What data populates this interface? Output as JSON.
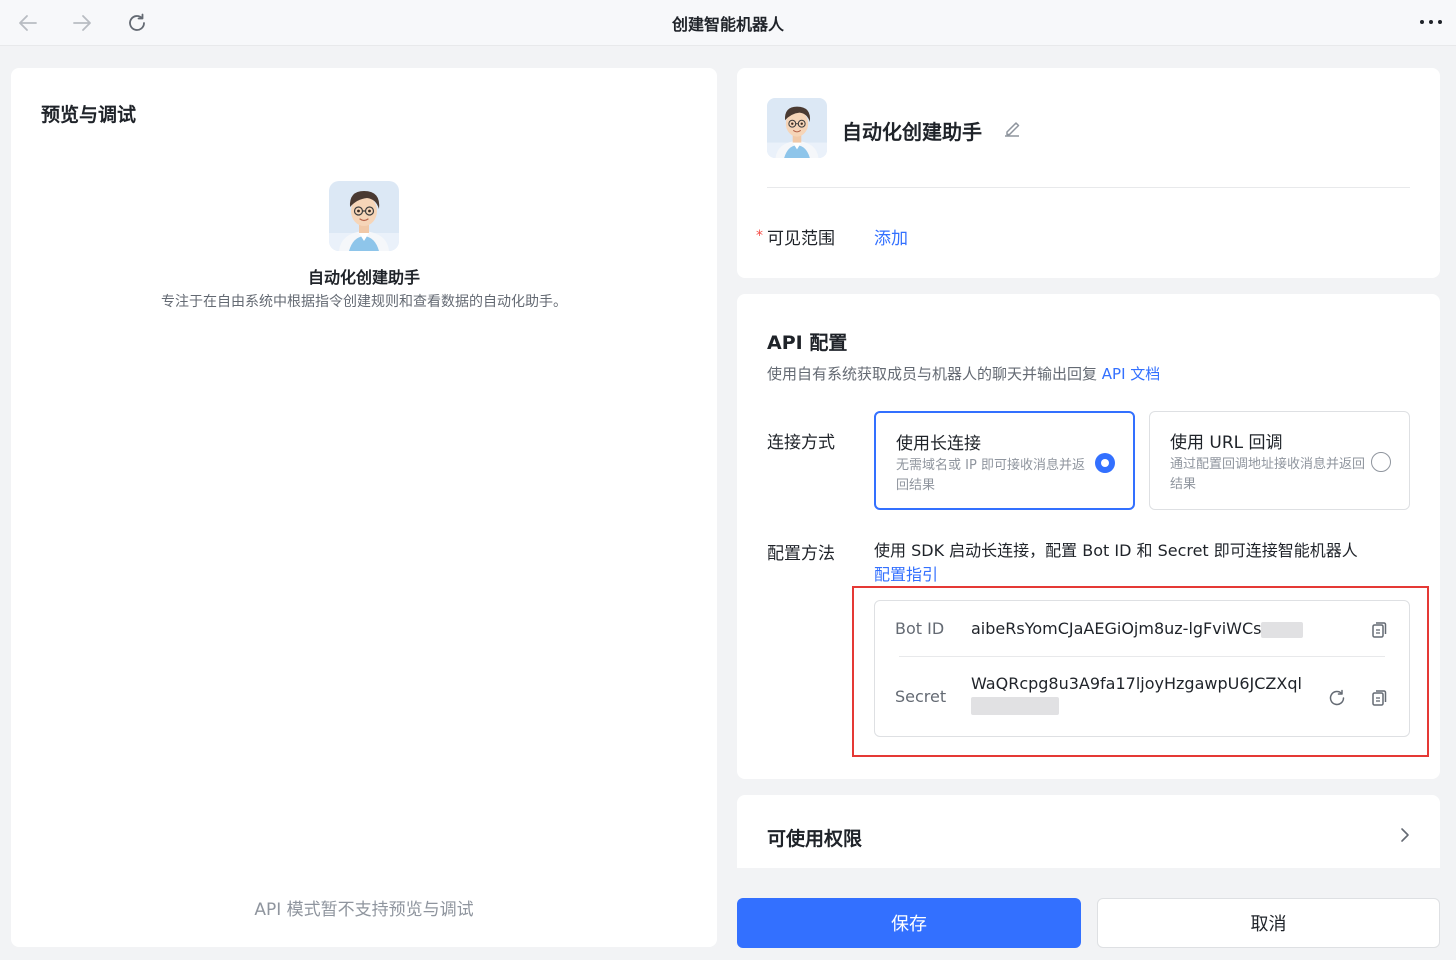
{
  "window": {
    "title": "创建智能机器人"
  },
  "icons": {
    "back": "arrow-left-icon",
    "forward": "arrow-right-icon",
    "refresh": "refresh-icon",
    "more": "more-icon",
    "edit": "pencil-icon",
    "copy": "copy-icon",
    "regenerate": "refresh-icon",
    "chevron": "chevron-right-icon"
  },
  "preview": {
    "title": "预览与调试",
    "bot_name": "自动化创建助手",
    "bot_desc": "专注于在自由系统中根据指令创建规则和查看数据的自动化助手。",
    "notice": "API 模式暂不支持预览与调试"
  },
  "profile": {
    "name": "自动化创建助手",
    "required_mark": "*",
    "visible_label": "可见范围",
    "visible_action": "添加"
  },
  "api": {
    "title": "API 配置",
    "desc": "使用自有系统获取成员与机器人的聊天并输出回复",
    "doc_link": "API 文档",
    "connection_label": "连接方式",
    "options": [
      {
        "title": "使用长连接",
        "desc": "无需域名或 IP 即可接收消息并返回结果",
        "selected": true
      },
      {
        "title": "使用 URL 回调",
        "desc": "通过配置回调地址接收消息并返回结果",
        "selected": false
      }
    ],
    "method_label": "配置方法",
    "method_text": "使用 SDK 启动长连接，配置 Bot ID 和 Secret 即可连接智能机器人",
    "method_link": "配置指引",
    "credentials": {
      "bot_id_label": "Bot ID",
      "bot_id_value": "aibeRsYomCJaAEGiOjm8uz-lgFviWCs",
      "secret_label": "Secret",
      "secret_value": "WaQRcpg8u3A9fa17ljoyHzgawpU6JCZXql"
    }
  },
  "permissions": {
    "title": "可使用权限"
  },
  "actions": {
    "save": "保存",
    "cancel": "取消"
  },
  "colors": {
    "accent": "#3370ff",
    "highlight": "#e53935",
    "background": "#f2f3f5"
  }
}
